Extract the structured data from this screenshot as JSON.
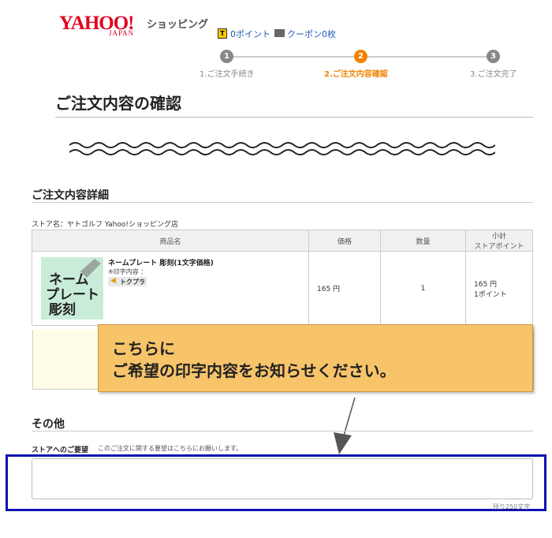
{
  "header": {
    "logo_main": "YAHOO!",
    "logo_sub": "JAPAN",
    "logo_service": "ショッピング",
    "points_label": "0ポイント",
    "coupon_label": "クーポン0枚"
  },
  "steps": [
    {
      "number": "1",
      "label": "1.ご注文手続き",
      "active": false
    },
    {
      "number": "2",
      "label": "2.ご注文内容確認",
      "active": true
    },
    {
      "number": "3",
      "label": "3.ご注文完了",
      "active": false
    }
  ],
  "page_title": "ご注文内容の確認",
  "order_detail": {
    "heading": "ご注文内容詳細",
    "store_label": "ストア名：ヤトゴルフ Yahoo!ショッピング店",
    "columns": [
      "商品名",
      "価格",
      "数量",
      "小計",
      "ストアポイント"
    ],
    "item": {
      "image_text": [
        "ネーム",
        "プレート",
        "彫刻"
      ],
      "name": "ネームプレート 彫刻(1文字価格)",
      "option": "※印字内容 ：",
      "badge": "トクプラ",
      "price": "165 円",
      "quantity": "1",
      "subtotal": "165 円",
      "points": "1ポイント"
    }
  },
  "callout": {
    "line1": "こちらに",
    "line2": "ご希望の印字内容をお知らせください。"
  },
  "other": {
    "heading": "その他",
    "request_label": "ストアへのご要望",
    "request_note": "このご注文に関する要望はこちらにお願いします。",
    "request_value": "",
    "remaining": "残り250文字"
  },
  "colors": {
    "accent": "#f08200",
    "highlight": "#1010b0",
    "callout": "#f7c46a"
  }
}
